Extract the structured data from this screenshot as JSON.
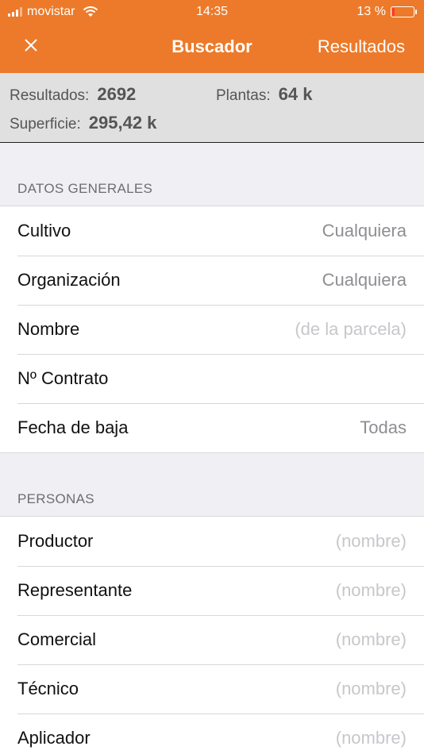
{
  "status_bar": {
    "carrier": "movistar",
    "time": "14:35",
    "battery": "13 %",
    "battery_level": 0.13
  },
  "navbar": {
    "title": "Buscador",
    "right_button": "Resultados",
    "close_icon": "close-icon"
  },
  "summary": {
    "resultados_label": "Resultados:",
    "resultados_value": "2692",
    "plantas_label": "Plantas:",
    "plantas_value": "64 k",
    "superficie_label": "Superficie:",
    "superficie_value": "295,42 k"
  },
  "sections": [
    {
      "header": "DATOS GENERALES",
      "rows": [
        {
          "label": "Cultivo",
          "value": "Cualquiera"
        },
        {
          "label": "Organización",
          "value": "Cualquiera"
        },
        {
          "label": "Nombre",
          "placeholder": "(de la parcela)"
        },
        {
          "label": "Nº Contrato",
          "placeholder": ""
        },
        {
          "label": "Fecha de baja",
          "value": "Todas"
        }
      ]
    },
    {
      "header": "PERSONAS",
      "rows": [
        {
          "label": "Productor",
          "placeholder": "(nombre)"
        },
        {
          "label": "Representante",
          "placeholder": "(nombre)"
        },
        {
          "label": "Comercial",
          "placeholder": "(nombre)"
        },
        {
          "label": "Técnico",
          "placeholder": "(nombre)"
        },
        {
          "label": "Aplicador",
          "placeholder": "(nombre)"
        }
      ]
    }
  ],
  "colors": {
    "accent": "#ec7a2a",
    "summary_bg": "#e0e0e0",
    "page_bg": "#efeff4",
    "battery_low": "#ff3b30"
  }
}
